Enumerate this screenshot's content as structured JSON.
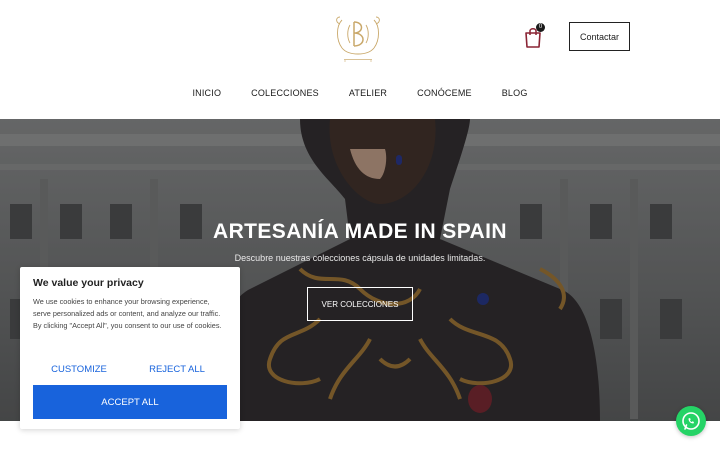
{
  "header": {
    "logo_icon": "monogram-b-logo-icon",
    "cart_icon": "shopping-bag-icon",
    "cart_count": "0",
    "contact_label": "Contactar"
  },
  "nav": {
    "items": [
      {
        "label": "INICIO"
      },
      {
        "label": "COLECCIONES"
      },
      {
        "label": "ATELIER"
      },
      {
        "label": "CONÓCEME"
      },
      {
        "label": "BLOG"
      }
    ]
  },
  "hero": {
    "title": "ARTESANÍA MADE IN SPAIN",
    "subtitle": "Descubre nuestras colecciones cápsula de unidades limitadas.",
    "button_label": "VER COLECCIONES"
  },
  "cookie_banner": {
    "title": "We value your privacy",
    "text": "We use cookies to enhance your browsing experience, serve personalized ads or content, and analyze our traffic. By clicking \"Accept All\", you consent to our use of cookies.",
    "customize_label": "CUSTOMIZE",
    "reject_label": "REJECT ALL",
    "accept_label": "ACCEPT ALL",
    "accent_color": "#1863dc"
  },
  "whatsapp": {
    "icon": "whatsapp-icon",
    "color": "#25d366"
  }
}
